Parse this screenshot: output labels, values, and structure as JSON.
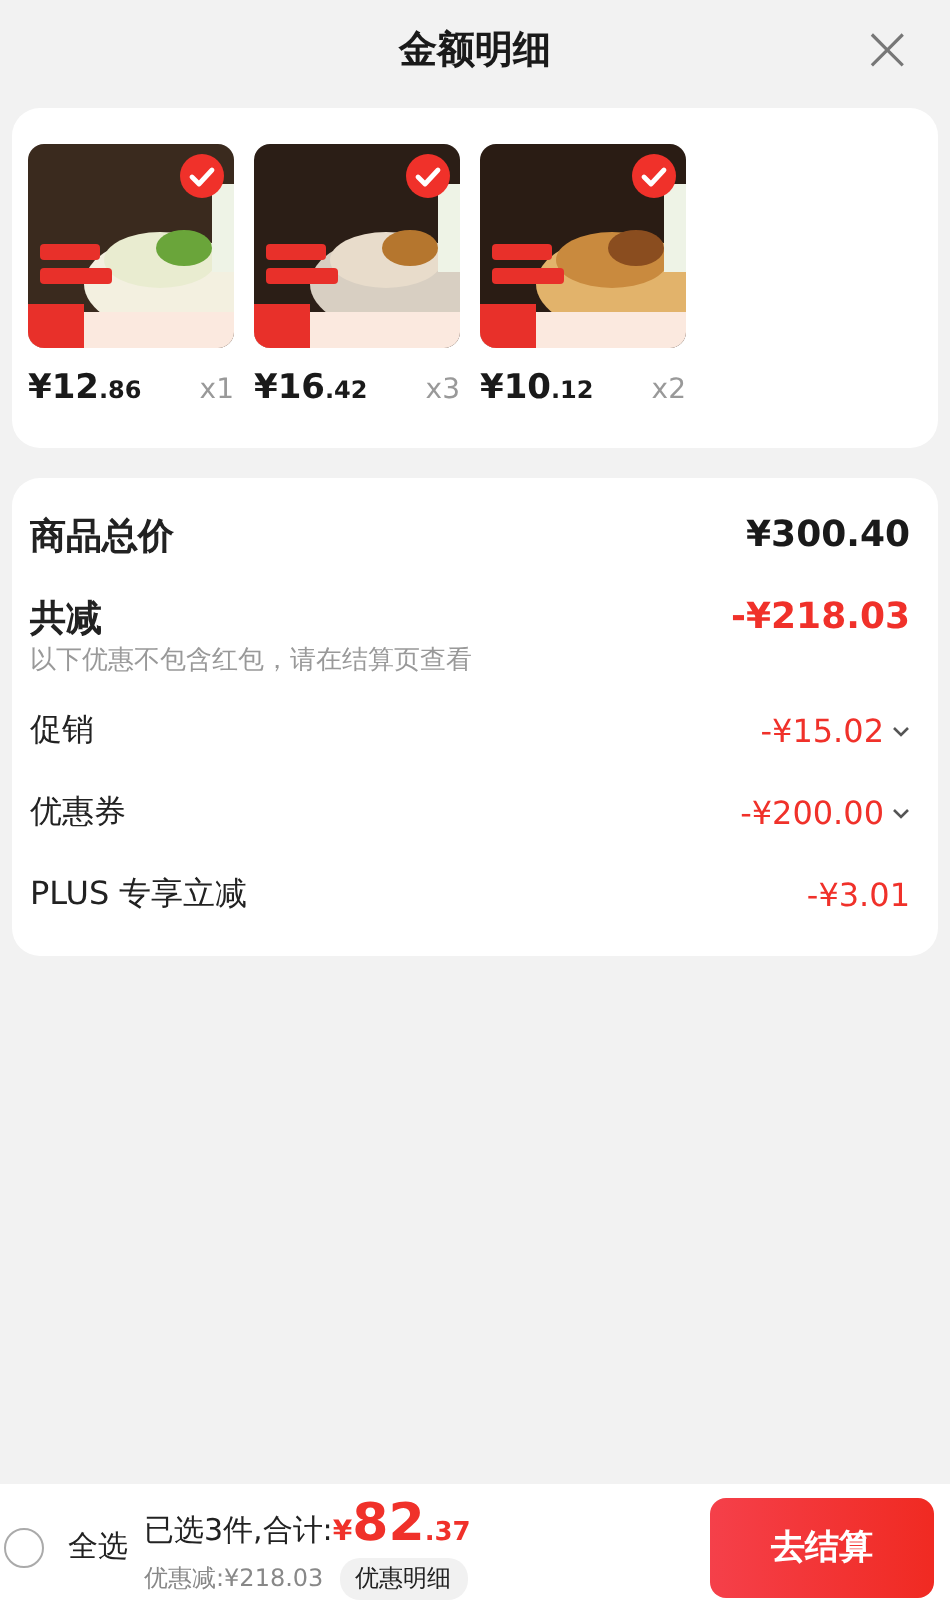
{
  "header": {
    "title": "金额明细",
    "close": "×"
  },
  "products": [
    {
      "selected": true,
      "price_int": "¥12",
      "price_dec": ".86",
      "quantity": "x1"
    },
    {
      "selected": true,
      "price_int": "¥16",
      "price_dec": ".42",
      "quantity": "x3"
    },
    {
      "selected": true,
      "price_int": "¥10",
      "price_dec": ".12",
      "quantity": "x2"
    }
  ],
  "summary": [
    {
      "kind": "total",
      "label": "商品总价",
      "value": "¥300.40"
    },
    {
      "kind": "discount",
      "label": "共减",
      "value": "-¥218.03",
      "note": "以下优惠不包含红包，请在结算页查看"
    },
    {
      "kind": "detail",
      "label": "促销",
      "value": "-¥15.02",
      "expandable": true
    },
    {
      "kind": "detail",
      "label": "优惠券",
      "value": "-¥200.00",
      "expandable": true
    },
    {
      "kind": "detail",
      "label": "PLUS 专享立减",
      "value": "-¥3.01",
      "expandable": false
    }
  ],
  "footer": {
    "select_all": {
      "label": "全选",
      "checked": false
    },
    "selected_text": "已选3件,合计:",
    "currency": "¥",
    "total_int": "82",
    "total_dec": ".37",
    "savings": "优惠减:¥218.03",
    "details_button": "优惠明细",
    "checkout_button": "去结算"
  }
}
